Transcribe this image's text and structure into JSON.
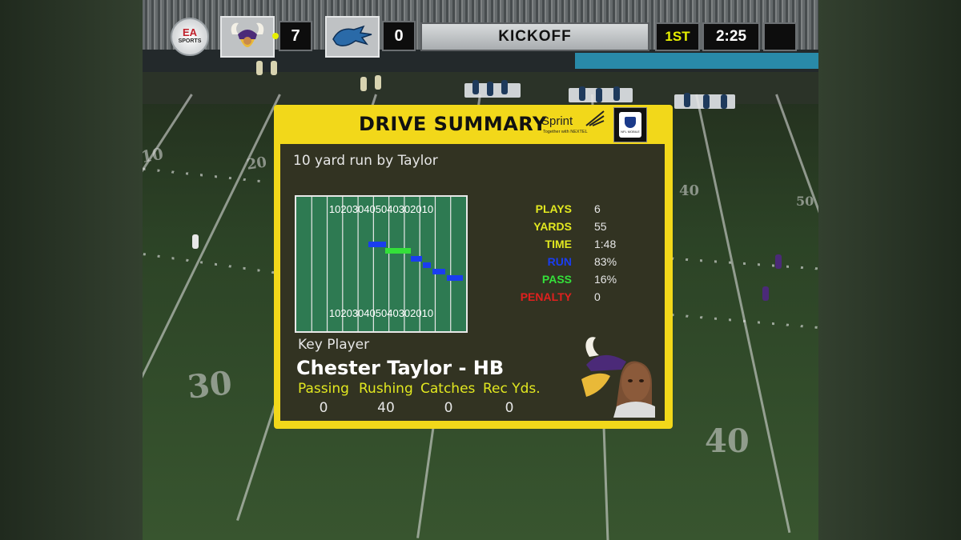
{
  "scoreboard": {
    "home_team_logo": "vikings-logo",
    "home_score": "7",
    "away_team_logo": "lions-logo",
    "away_score": "0",
    "status": "KICKOFF",
    "quarter": "1ST",
    "clock": "2:25",
    "possession_indicator_color": "#e7f000",
    "ea_logo_text": "EA",
    "ea_logo_sub": "SPORTS"
  },
  "field": {
    "yard_numbers": [
      "10",
      "20",
      "30",
      "40",
      "50",
      "40",
      "30",
      "20",
      "10",
      "30",
      "40",
      "40",
      "50",
      "40"
    ]
  },
  "drive_summary": {
    "title": "DRIVE SUMMARY",
    "sponsor": "Sprint",
    "sponsor_tagline": "Together with NEXTEL",
    "sponsor_badge": "NFL MOBILE",
    "last_play": "10 yard run by Taylor",
    "mini_field": {
      "top_numbers": [
        "10",
        "20",
        "30",
        "40",
        "50",
        "40",
        "30",
        "20",
        "10"
      ],
      "bottom_numbers": [
        "10",
        "20",
        "30",
        "40",
        "50",
        "40",
        "30",
        "20",
        "10"
      ],
      "segments": [
        {
          "type": "run",
          "color": "#1a3df0"
        },
        {
          "type": "pass",
          "color": "#34e03a"
        },
        {
          "type": "run",
          "color": "#1a3df0"
        },
        {
          "type": "run",
          "color": "#1a3df0"
        },
        {
          "type": "run",
          "color": "#1a3df0"
        },
        {
          "type": "run",
          "color": "#1a3df0"
        }
      ]
    },
    "stats": [
      {
        "label": "PLAYS",
        "value": "6",
        "color": "#e2e820"
      },
      {
        "label": "YARDS",
        "value": "55",
        "color": "#e2e820"
      },
      {
        "label": "TIME",
        "value": "1:48",
        "color": "#e2e820"
      },
      {
        "label": "RUN",
        "value": "83%",
        "color": "#1a3df0"
      },
      {
        "label": "PASS",
        "value": "16%",
        "color": "#34e03a"
      },
      {
        "label": "PENALTY",
        "value": "0",
        "color": "#e0201e"
      }
    ],
    "key_player": {
      "heading": "Key Player",
      "name": "Chester Taylor - HB",
      "columns": [
        "Passing",
        "Rushing",
        "Catches",
        "Rec Yds."
      ],
      "values": [
        "0",
        "40",
        "0",
        "0"
      ],
      "team_logo": "vikings-logo",
      "portrait": "player-portrait"
    }
  },
  "colors": {
    "panel_yellow": "#f2d81a",
    "accent_yellow": "#e2e820",
    "field_green": "#2e7a52"
  }
}
